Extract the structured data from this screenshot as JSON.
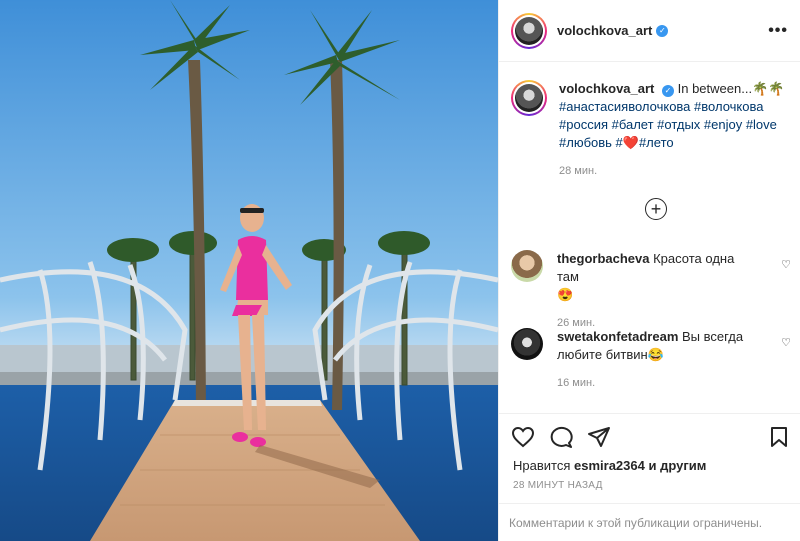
{
  "post": {
    "username": "volochkova_art",
    "more_label": "•••"
  },
  "caption": {
    "username": "volochkova_art",
    "text": "In between...",
    "emoji": "🌴🌴",
    "tags_line1": "#анастасияволочкова #волочкова",
    "tags_line2": "#россия #балет #отдых #enjoy #love",
    "tags_line3a": "#любовь #",
    "tags_line3_heart": "❤️",
    "tags_line3b": "#лето",
    "time": "28 мин."
  },
  "load_more_label": "+",
  "comments": [
    {
      "username": "thegorbacheva",
      "text": "Красота одна там",
      "emoji": "😍",
      "time": "26 мин."
    },
    {
      "username": "swetakonfetadream",
      "text": "Вы всегда любите битвин",
      "emoji": "😂",
      "time": "16 мин."
    }
  ],
  "likes": {
    "prefix": "Нравится",
    "user": "esmira2364",
    "suffix": "и другим"
  },
  "posted_ago": "28 МИНУТ НАЗАД",
  "restricted_note": "Комментарии к этой публикации ограничены.",
  "colors": {
    "link": "#00376b",
    "verified": "#3897f0",
    "muted": "#8e8e8e"
  }
}
